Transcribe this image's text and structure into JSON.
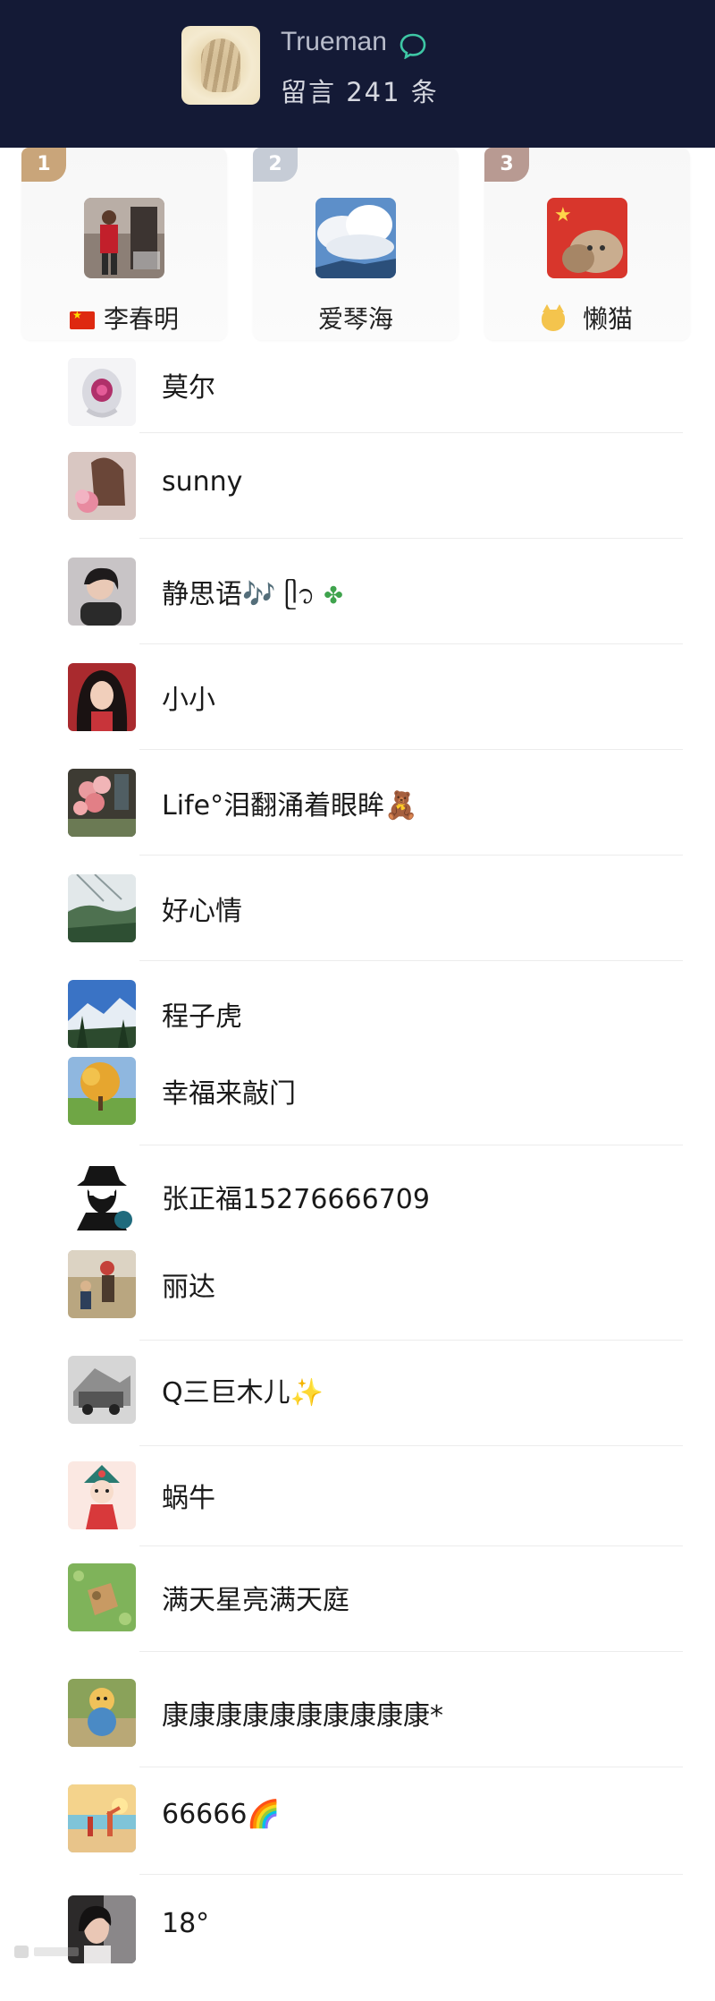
{
  "header": {
    "name": "Trueman",
    "comment_count": "留言 241 条"
  },
  "podium": [
    {
      "rank": "1",
      "name": "李春明",
      "badge_color": "#c9a57a"
    },
    {
      "rank": "2",
      "name": "爱琴海",
      "badge_color": "#c6ccd6"
    },
    {
      "rank": "3",
      "name": "懒猫",
      "badge_color": "#b89a92"
    }
  ],
  "commenters": [
    {
      "name": "莫尔",
      "avatar": "jewel-ring"
    },
    {
      "name": "sunny",
      "avatar": "woman-flowers"
    },
    {
      "name": "静思语🎶 ᥫ᭡ ",
      "avatar": "woman-portrait"
    },
    {
      "name": "小小",
      "avatar": "woman-red"
    },
    {
      "name": "Life°泪翻涌着眼眸🧸",
      "avatar": "pink-flowers"
    },
    {
      "name": "好心情",
      "avatar": "landscape-tree"
    },
    {
      "name": "程子虎",
      "avatar": "mountain-sky"
    },
    {
      "name": "幸福来敲门",
      "avatar": "tree-field"
    },
    {
      "name": "张正福15276666709",
      "avatar": "detective"
    },
    {
      "name": "丽达",
      "avatar": "couple-outdoor"
    },
    {
      "name": "Q三巨木儿✨",
      "avatar": "bw-street"
    },
    {
      "name": "蜗牛",
      "avatar": "opera-figure"
    },
    {
      "name": "满天星亮满天庭",
      "avatar": "green-cartoon"
    },
    {
      "name": "康康康康康康康康康康*",
      "avatar": "baby-toy"
    },
    {
      "name": "66666🌈",
      "avatar": "beach-sunset"
    },
    {
      "name": "18°",
      "avatar": "girl-portrait"
    }
  ],
  "colors": {
    "header_bg": "#141a36",
    "chat_icon": "#3ec7a5"
  }
}
